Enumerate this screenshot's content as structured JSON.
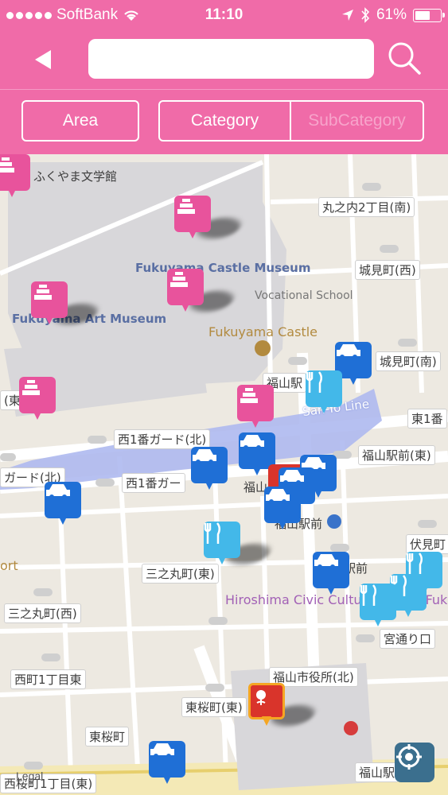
{
  "status_bar": {
    "carrier": "SoftBank",
    "time": "11:10",
    "battery": "61%"
  },
  "nav": {
    "search_placeholder": "",
    "search_value": ""
  },
  "filters": {
    "area": "Area",
    "category": "Category",
    "subcategory": "SubCategory"
  },
  "map": {
    "labels": {
      "bungakukan": "ふくやま文学館",
      "marunouchi2": "丸之内2丁目(南)",
      "jokencho_west": "城見町(西)",
      "fukuyama_castle_museum": "Fukuyama Castle Museum",
      "vocational_school": "Vocational School",
      "fukuyama_art_museum": "Fukuyama Art Museum",
      "fukuyama_castle": "Fukuyama Castle",
      "jokencho_south": "城見町(南)",
      "fukuyama_station": "福山駅",
      "east_edge": "(東)",
      "sanyo_line": "San-Yo Line",
      "higashi1": "東1番",
      "nishi1_guard_north": "西1番ガード(北)",
      "fukuyama_ekimae_east": "福山駅前(東)",
      "guard_north": "ガード(北)",
      "nishi1_guard": "西1番ガー",
      "fukuyama_short": "福山",
      "fukuyama_ekimae": "福山駅前",
      "fushimi": "伏見町",
      "port_fragment": "ort",
      "sannomaru_east": "三之丸町(東)",
      "ekimae_frag": "駅前",
      "sannomaru_west": "三之丸町(西)",
      "hiroshima_civic": "Hiroshima Civic Culture Center Fukuyama",
      "miyadori": "宮通り口",
      "nishimachi1": "西町1丁目東",
      "city_hall_north": "福山市役所(北)",
      "higashisakura_east": "東桜町(東)",
      "higashisakura": "東桜町",
      "nishimachi1_east": "西桜町1丁目(東)",
      "fukuyama_station_bottom": "福山駅"
    },
    "legal": "Legal"
  },
  "icons": {
    "back": "back-arrow-icon",
    "search": "magnifier-icon",
    "location": "current-location-icon",
    "museum": "castle-museum-icon",
    "taxi": "taxi-icon",
    "restaurant": "fork-knife-icon"
  },
  "colors": {
    "brand": "#f06ba8",
    "museum_pin": "#e8539c",
    "taxi_pin": "#1f6fd6",
    "food_pin": "#43b8e9",
    "station_pin": "#d9342b"
  }
}
